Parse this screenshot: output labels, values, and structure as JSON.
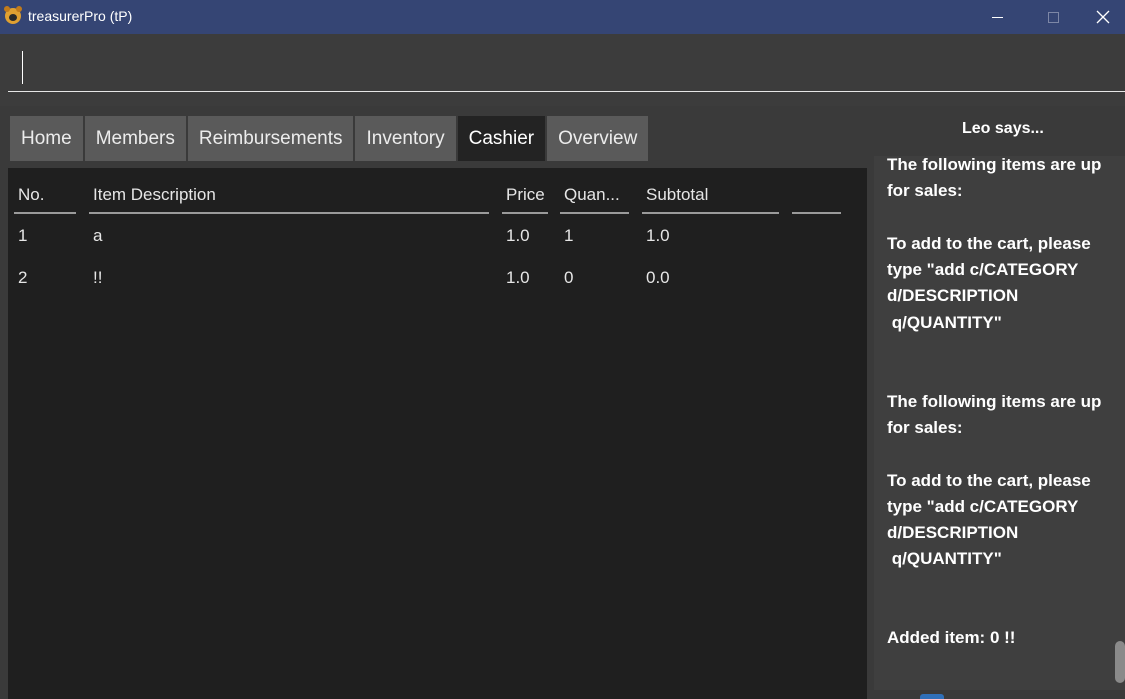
{
  "window": {
    "title": "treasurerPro (tP)"
  },
  "command": {
    "value": ""
  },
  "tabs": [
    {
      "label": "Home"
    },
    {
      "label": "Members"
    },
    {
      "label": "Reimbursements"
    },
    {
      "label": "Inventory"
    },
    {
      "label": "Cashier",
      "active": true
    },
    {
      "label": "Overview"
    }
  ],
  "table": {
    "columns": [
      "No.",
      "Item Description",
      "Price",
      "Quan...",
      "Subtotal",
      ""
    ],
    "rows": [
      [
        "1",
        "a",
        "1.0",
        "1",
        "1.0"
      ],
      [
        "2",
        "!!",
        "1.0",
        "0",
        "0.0"
      ]
    ]
  },
  "assistant": {
    "title": "Leo says...",
    "message": "The following items are up for sales:\n\nTo add to the cart, please type \"add c/CATEGORY d/DESCRIPTION\n q/QUANTITY\"\n\n\nThe following items are up for sales:\n\nTo add to the cart, please type \"add c/CATEGORY d/DESCRIPTION\n q/QUANTITY\"\n\n\nAdded item: 0 !!"
  }
}
